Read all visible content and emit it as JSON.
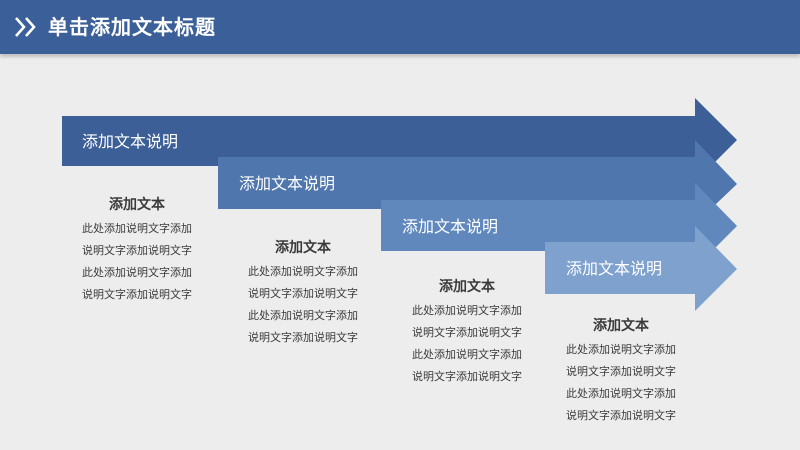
{
  "header": {
    "title": "单击添加文本标题",
    "icon": "double-chevron-right-icon",
    "background": "#3b5f98"
  },
  "steps": [
    {
      "arrow_label": "添加文本说明",
      "color": "#3d5f97",
      "desc_title": "添加文本",
      "desc_lines": [
        "此处添加说明文字添加",
        "说明文字添加说明文字",
        "此处添加说明文字添加",
        "说明文字添加说明文字"
      ]
    },
    {
      "arrow_label": "添加文本说明",
      "color": "#4f76ad",
      "desc_title": "添加文本",
      "desc_lines": [
        "此处添加说明文字添加",
        "说明文字添加说明文字",
        "此处添加说明文字添加",
        "说明文字添加说明文字"
      ]
    },
    {
      "arrow_label": "添加文本说明",
      "color": "#6088bd",
      "desc_title": "添加文本",
      "desc_lines": [
        "此处添加说明文字添加",
        "说明文字添加说明文字",
        "此处添加说明文字添加",
        "说明文字添加说明文字"
      ]
    },
    {
      "arrow_label": "添加文本说明",
      "color": "#7ea1cd",
      "desc_title": "添加文本",
      "desc_lines": [
        "此处添加说明文字添加",
        "说明文字添加说明文字",
        "此处添加说明文字添加",
        "说明文字添加说明文字"
      ]
    }
  ]
}
